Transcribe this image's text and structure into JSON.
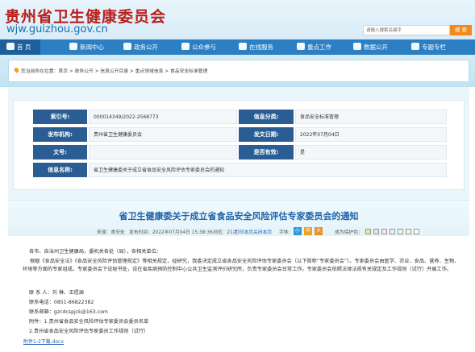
{
  "header": {
    "site_name_cn": "贵州省卫生健康委员会",
    "site_name_en": "wjw.guizhou.gov.cn",
    "search_placeholder": "请输入搜索关键字",
    "search_button": "搜 索"
  },
  "nav": {
    "items": [
      {
        "label": "首 页",
        "icon": "home-icon"
      },
      {
        "label": "新闻中心",
        "icon": "newspaper-icon"
      },
      {
        "label": "政务公开",
        "icon": "folder-icon"
      },
      {
        "label": "公众参与",
        "icon": "chat-icon"
      },
      {
        "label": "在线服务",
        "icon": "monitor-icon"
      },
      {
        "label": "重点工作",
        "icon": "flag-icon"
      },
      {
        "label": "数据公开",
        "icon": "chart-icon"
      },
      {
        "label": "专题专栏",
        "icon": "grid-icon"
      }
    ]
  },
  "breadcrumb": {
    "prefix": "您当前所在位置：",
    "items": [
      "首页",
      "政务公开",
      "信息公开目录",
      "重点领域信息",
      "食品安全标准管理"
    ],
    "separator": " > "
  },
  "meta": {
    "index_label": "索引号:",
    "index_value": "000014349/2022-2568773",
    "category_label": "信息分类:",
    "category_value": "食品安全标准管理",
    "publisher_label": "发布机构:",
    "publisher_value": "贵州省卫生健康委员会",
    "date_label": "发文日期:",
    "date_value": "2022年07月04日",
    "docno_label": "文号:",
    "docno_value": "",
    "valid_label": "是否有效:",
    "valid_value": "是",
    "name_label": "信息名称:",
    "name_value": "省卫生健康委关于成立省食品安全风险评估专家委员会的通知"
  },
  "article": {
    "title": "省卫生健康委关于成立省食品安全风险评估专家委员会的通知",
    "source": "来源：食安处",
    "publish_time": "发布时间：2022年07月04日 15:38:36",
    "views": "浏览：21次",
    "print": "打印本页",
    "close": "关闭本页",
    "font_label": "字体:",
    "font_small": "小",
    "font_medium": "中",
    "font_large": "大",
    "guard_label": "成为保护色：",
    "swatch_colors": [
      "#f0e68c",
      "#e3e3e3",
      "#ffe4e1",
      "#e6f0ff",
      "#e0ffe0",
      "#f5f5dc",
      "#ffffff"
    ],
    "greeting": "各市、自治州卫生健康局，委机关各处（局），各相关单位：",
    "paragraph": "根据《食品安全法》《食品安全风险评估管理规定》等相关规定，经研究，我委决定成立省食品安全风险评估专家委员会（以下简称“专家委员会”）。专家委员会由医学、农业、食品、营养、生物、环境等方面的专家组成。专家委员会下设秘书处，设在省疾病预防控制中心公共卫生监测评价研究所，负责专家委员会日常工作。专家委员会依照法律法规有关规定及工作规则（试行）开展工作。",
    "contact": "联 系 人：刘  琳、王煜澜",
    "phone": "联系电话：0851-86822382",
    "email": "联系邮箱：gzcdcspjck@163.com",
    "attachment_head": "附件：1.贵州省食品安全风险评估专家委员会委员名单",
    "attachment_2": "2.贵州省食品安全风险评估专家委员工作规则（试行）",
    "attachment_link": "附件1-2下载.docx"
  },
  "colors": {
    "nav_blue": "#2b7fc2",
    "label_blue": "#2a5d94",
    "title_blue": "#1e63a8",
    "brand_red": "#b8201c",
    "search_orange": "#f28a1a"
  }
}
